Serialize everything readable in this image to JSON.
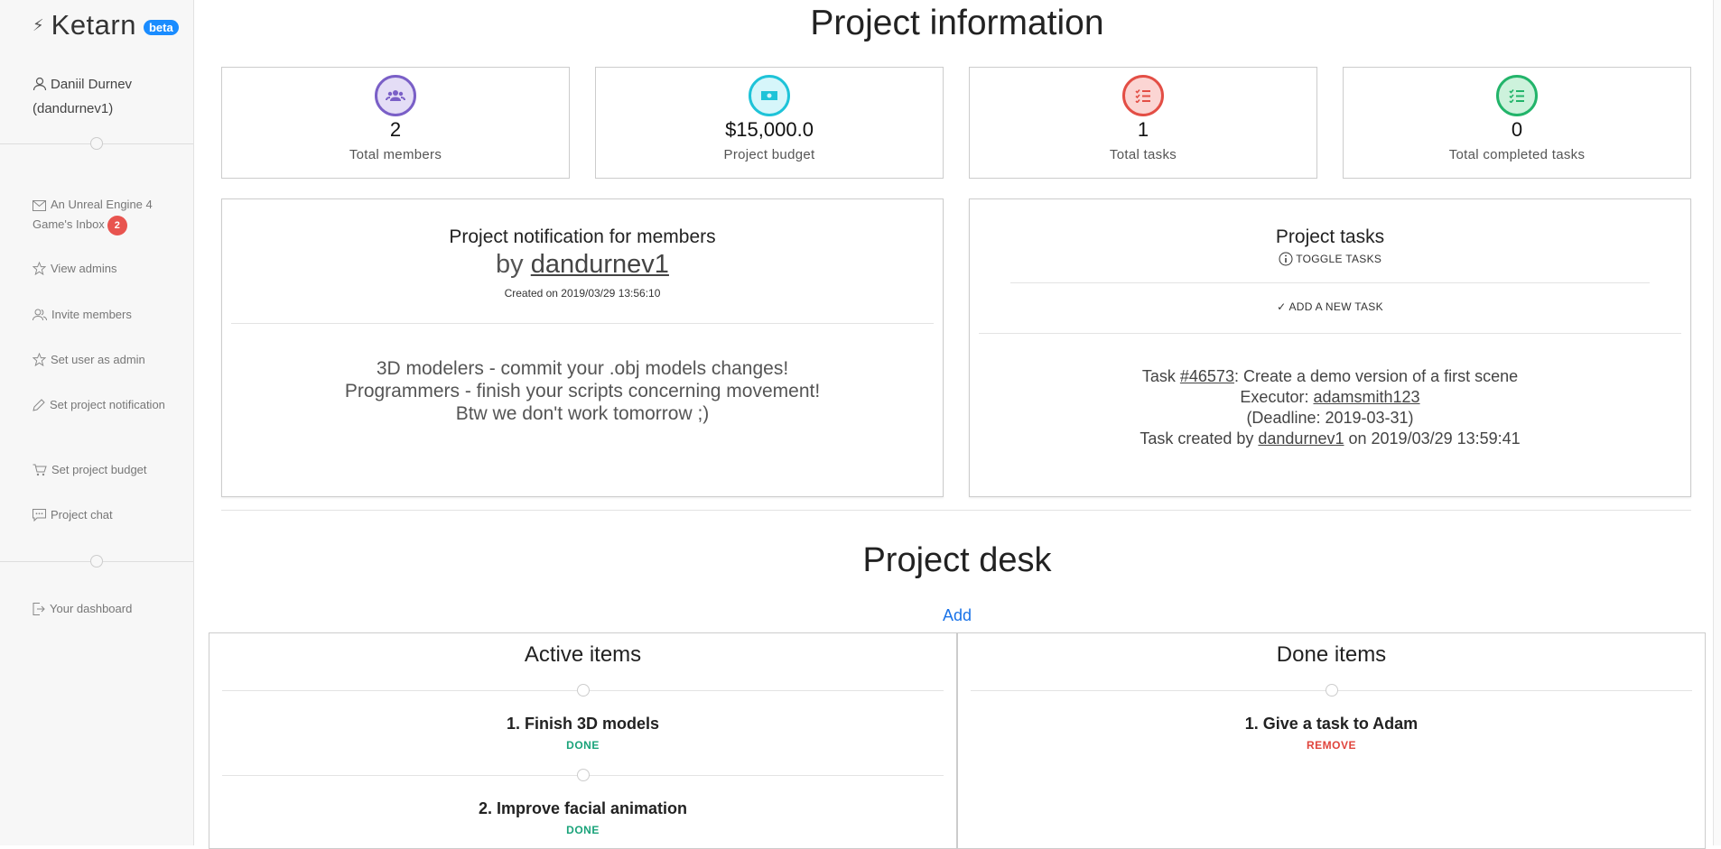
{
  "sidebar": {
    "brand": "Ketarn",
    "beta": "beta",
    "user": "Daniil Durnev (dandurnev1)",
    "inbox_label": "An Unreal Engine 4 Game's Inbox",
    "inbox_count": "2",
    "items": [
      {
        "label": "View admins",
        "icon": "star-icon"
      },
      {
        "label": "Invite members",
        "icon": "users-icon"
      },
      {
        "label": "Set user as admin",
        "icon": "star-icon"
      },
      {
        "label": "Set project notification",
        "icon": "pencil-icon"
      },
      {
        "label": "Set project budget",
        "icon": "cart-icon"
      },
      {
        "label": "Project chat",
        "icon": "chat-icon"
      }
    ],
    "dashboard": "Your dashboard"
  },
  "header": {
    "title": "Project information"
  },
  "stats": [
    {
      "value": "2",
      "label": "Total members",
      "color": "#7a5fc7",
      "bg": "#e4ddf6"
    },
    {
      "value": "$15,000.0",
      "label": "Project budget",
      "color": "#1ec3d8",
      "bg": "#d6f6fa"
    },
    {
      "value": "1",
      "label": "Total tasks",
      "color": "#e34e45",
      "bg": "#fbd5d3"
    },
    {
      "value": "0",
      "label": "Total completed tasks",
      "color": "#22b46a",
      "bg": "#cdf2dc"
    }
  ],
  "notification": {
    "title": "Project notification for members",
    "by": "by",
    "author": "dandurnev1",
    "created": "Created on 2019/03/29 13:56:10",
    "lines": [
      "3D modelers - commit your .obj models changes!",
      "Programmers - finish your scripts concerning movement!",
      "Btw we don't work tomorrow ;)"
    ]
  },
  "tasks": {
    "title": "Project tasks",
    "toggle": "TOGGLE TASKS",
    "add": "ADD A NEW TASK",
    "task": {
      "prefix": "Task",
      "id": "#46573",
      "desc": ": Create a demo version of a first scene",
      "executor_label": "Executor:",
      "executor": "adamsmith123",
      "deadline": "(Deadline: 2019-03-31)",
      "created_prefix": "Task created by",
      "created_by": "dandurnev1",
      "created_on": "on 2019/03/29 13:59:41"
    }
  },
  "desk": {
    "title": "Project desk",
    "add": "Add",
    "active_title": "Active items",
    "done_title": "Done items",
    "active": [
      {
        "name": "1. Finish 3D models",
        "action": "DONE"
      },
      {
        "name": "2. Improve facial animation",
        "action": "DONE"
      }
    ],
    "done": [
      {
        "name": "1. Give a task to Adam",
        "action": "REMOVE"
      }
    ],
    "done_color": "#1aa37a",
    "remove_color": "#e0443c"
  }
}
